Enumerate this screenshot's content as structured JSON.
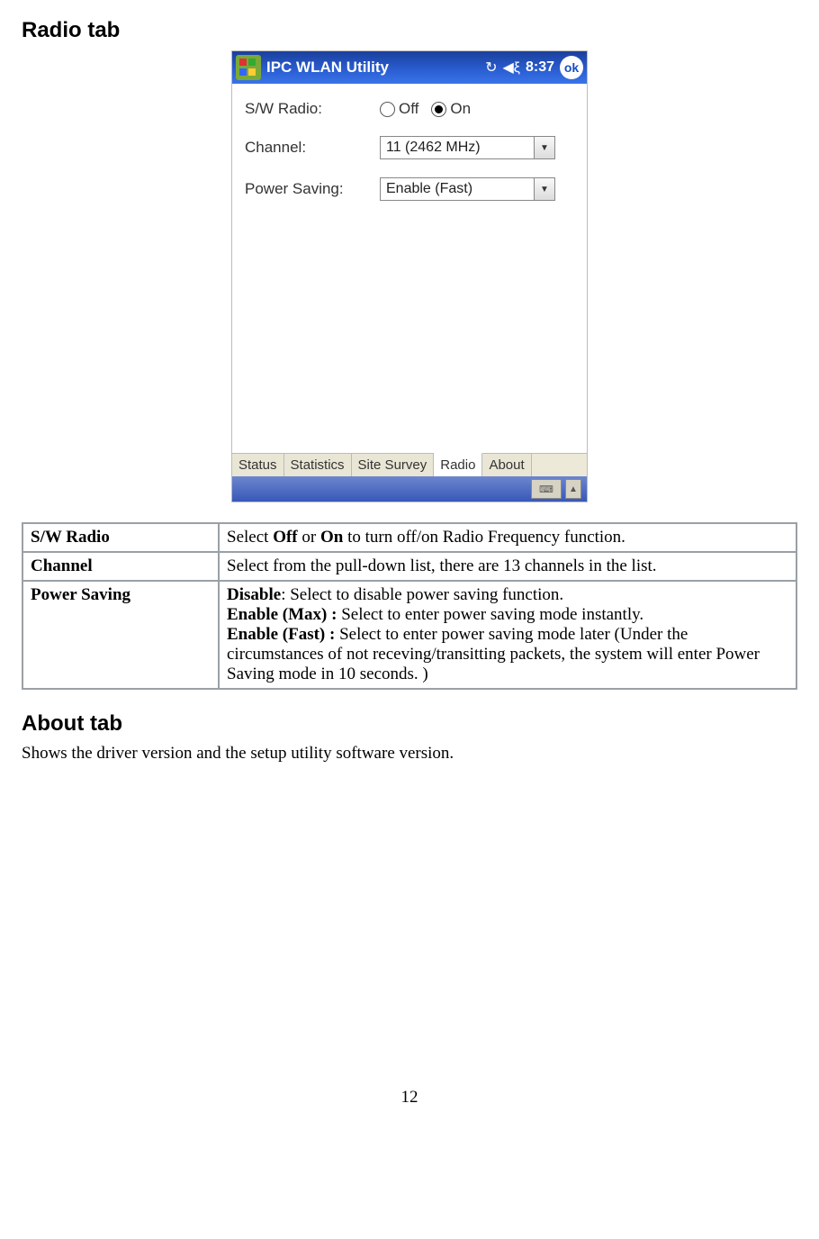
{
  "sections": {
    "radio_heading": "Radio tab",
    "about_heading": "About tab",
    "about_text": "Shows the driver version and the setup utility software version."
  },
  "device": {
    "title": "IPC WLAN Utility",
    "time": "8:37",
    "ok": "ok",
    "labels": {
      "sw_radio": "S/W Radio:",
      "channel": "Channel:",
      "power_saving": "Power Saving:"
    },
    "radio": {
      "off": "Off",
      "on": "On",
      "selected": "on"
    },
    "channel_value": "11 (2462 MHz)",
    "power_value": "Enable (Fast)",
    "tabs": [
      "Status",
      "Statistics",
      "Site Survey",
      "Radio",
      "About"
    ],
    "active_tab": "Radio"
  },
  "spec": {
    "r1_key": "S/W Radio",
    "r1_pre": "Select ",
    "r1_off": "Off",
    "r1_mid": " or ",
    "r1_on": "On",
    "r1_post": " to turn off/on Radio Frequency function.",
    "r2_key": "Channel",
    "r2_val": "Select from the pull-down list, there are 13 channels in the list.",
    "r3_key": "Power Saving",
    "r3_disable_b": "Disable",
    "r3_disable_t": ": Select to disable power saving function.",
    "r3_max_b": "Enable (Max) : ",
    "r3_max_t": "Select to enter power saving mode instantly.",
    "r3_fast_b": "Enable (Fast) : ",
    "r3_fast_t": "Select to enter power saving mode later (Under the circumstances of not receving/transitting packets, the system will enter Power Saving mode in 10 seconds. )"
  },
  "page_number": "12"
}
